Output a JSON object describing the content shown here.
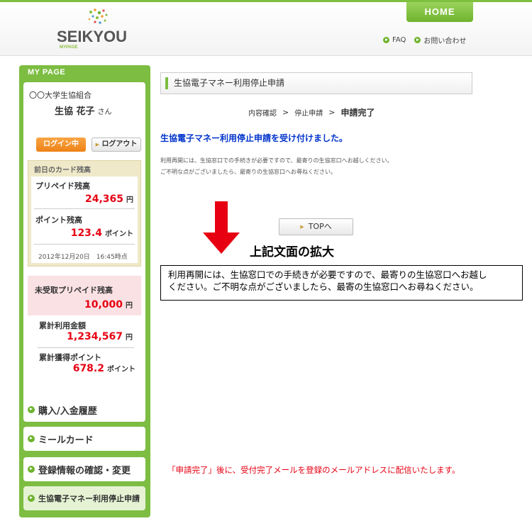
{
  "header": {
    "home_tab": "HOME",
    "logo_text": "SEIKYOU",
    "logo_sub": "MYPAGE",
    "faq": "FAQ",
    "contact": "お問い合わせ"
  },
  "sidebar": {
    "title": "MY PAGE",
    "coop_name": "〇〇大学生協組合",
    "user_name": "生協 花子",
    "honorific": "さん",
    "login_status": "ログイン中",
    "logout": "ログアウト",
    "balance_heading": "前日のカード残高",
    "prepaid_label": "プリペイド残高",
    "prepaid_value": "24,365",
    "yen": "円",
    "point_label": "ポイント残高",
    "point_value": "123.4",
    "point_unit": "ポイント",
    "date": "2012年12月20日　16:45時点",
    "unreceived_label": "未受取プリペイド残高",
    "unreceived_value": "10,000",
    "total_use_label": "累計利用金額",
    "total_use_value": "1,234,567",
    "total_points_label": "累計獲得ポイント",
    "total_points_value": "678.2",
    "menu": [
      {
        "label": "購入/入金履歴"
      },
      {
        "label": "ミールカード"
      },
      {
        "label": "登録情報の確認・変更"
      },
      {
        "label": "生協電子マネー利用停止申請"
      }
    ]
  },
  "main": {
    "page_title": "生協電子マネー利用停止申請",
    "steps": [
      "内容確認",
      "停止申請",
      "申請完了"
    ],
    "step_sep": ">",
    "accepted_message": "生協電子マネー利用停止申請を受け付けました。",
    "note_line1": "利用再開には、生協窓口での手続きが必要ですので、最寄りの生協窓口へお越しください。",
    "note_line2": "ご不明な点がございましたら、最寄りの生協窓口へお尋ねください。",
    "top_button": "TOPへ",
    "enlarge_title": "上記文面の拡大",
    "enlarge_line1": "利用再開には、生協窓口での手続きが必要ですので、最寄りの生協窓口へお越し",
    "enlarge_line2": "ください。ご不明な点がございましたら、最寄の生協窓口へお尋ねください。",
    "bottom_note": "「申請完了」後に、受付完了メールを登録のメールアドレスに配信いたします。"
  },
  "colors": {
    "brand_green": "#7cbd42",
    "accent_red": "#e60012",
    "link_blue": "#0033cc",
    "login_orange": "#ee8217"
  }
}
